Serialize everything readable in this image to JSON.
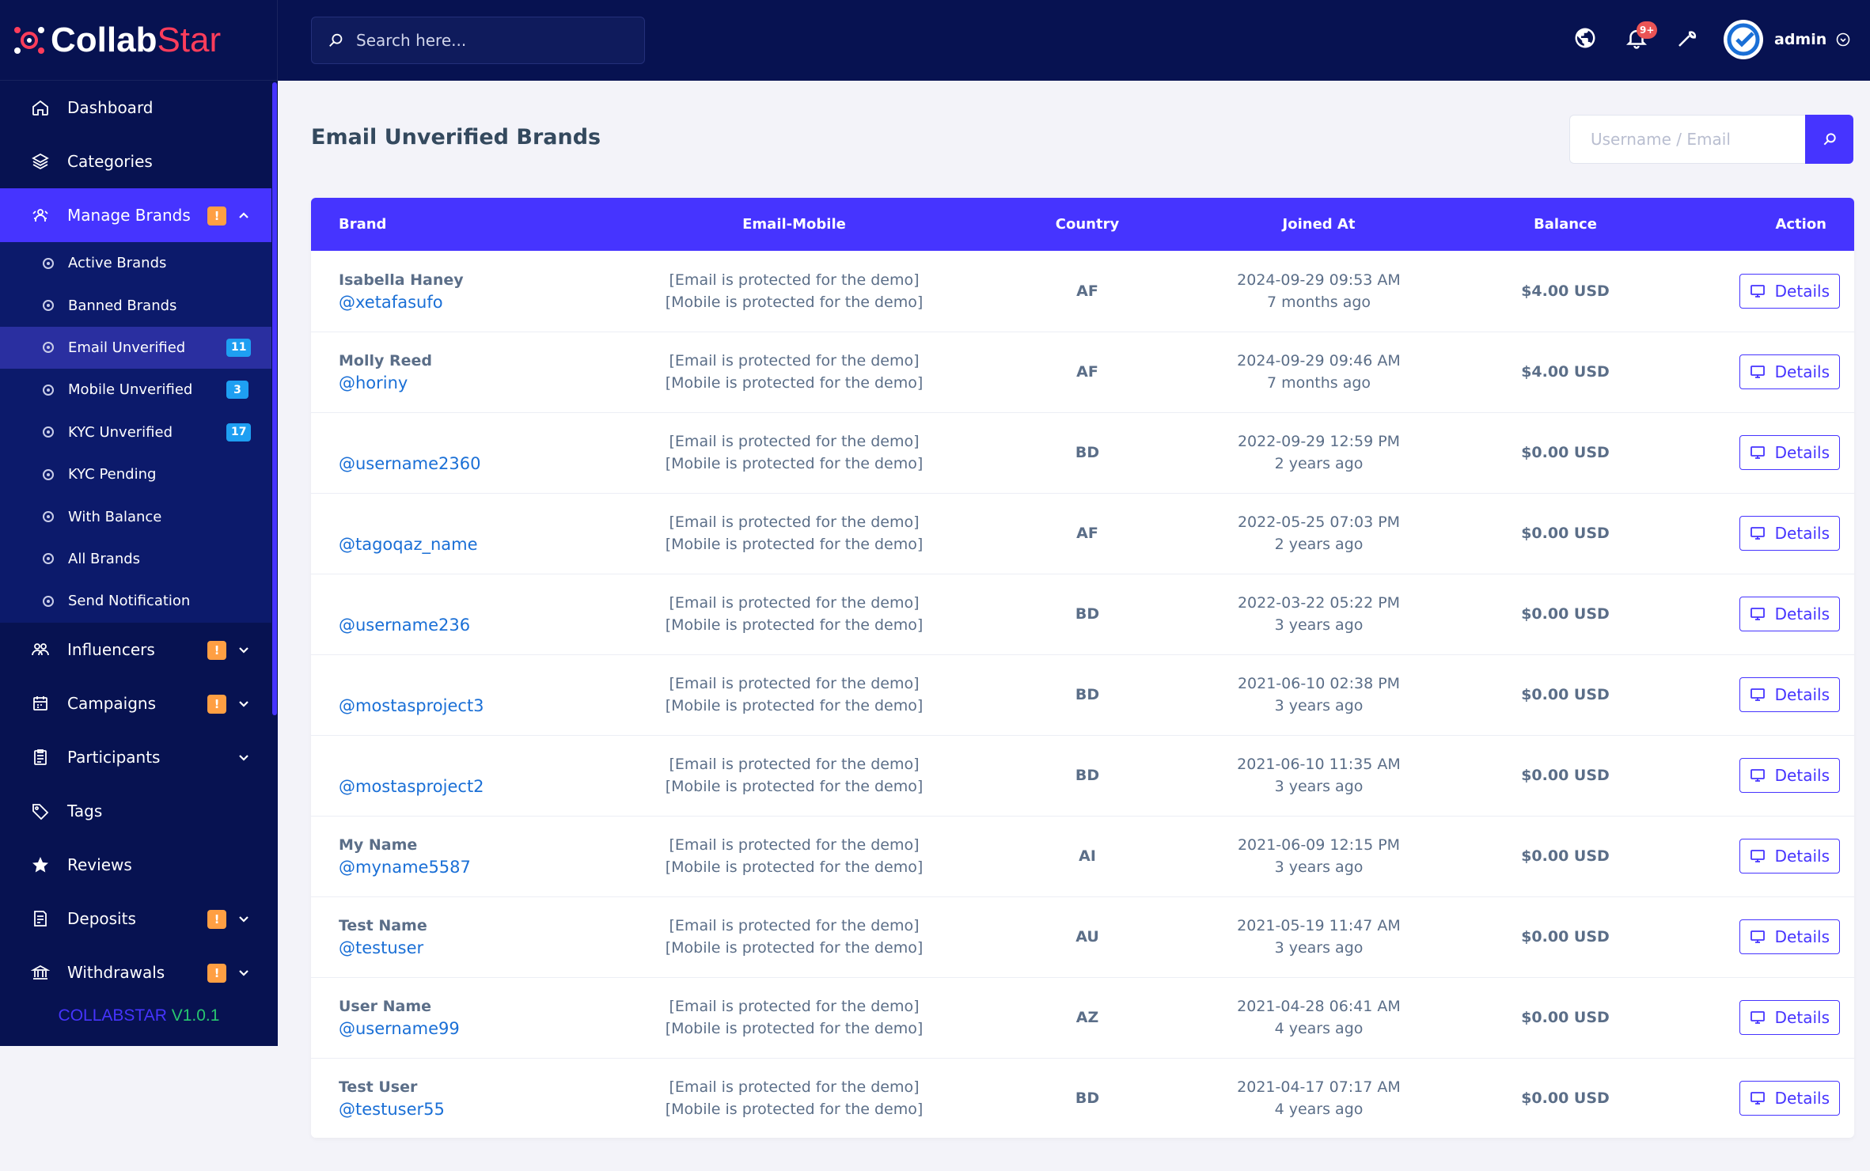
{
  "app": {
    "brand_main": "Collab",
    "brand_accent": "Star",
    "version_name": "COLLABSTAR",
    "version_number": "V1.0.1"
  },
  "sidebar": {
    "items": [
      {
        "label": "Dashboard",
        "icon": "home-icon"
      },
      {
        "label": "Categories",
        "icon": "layers-icon"
      },
      {
        "label": "Manage Brands",
        "icon": "brands-icon",
        "warn": "!",
        "expanded": true
      },
      {
        "label": "Influencers",
        "icon": "users-icon",
        "warn": "!"
      },
      {
        "label": "Campaigns",
        "icon": "calendar-icon",
        "warn": "!"
      },
      {
        "label": "Participants",
        "icon": "clipboard-icon"
      },
      {
        "label": "Tags",
        "icon": "tag-icon"
      },
      {
        "label": "Reviews",
        "icon": "star-icon"
      },
      {
        "label": "Deposits",
        "icon": "receipt-icon",
        "warn": "!"
      },
      {
        "label": "Withdrawals",
        "icon": "bank-icon",
        "warn": "!"
      }
    ],
    "submenu": [
      {
        "label": "Active Brands"
      },
      {
        "label": "Banned Brands"
      },
      {
        "label": "Email Unverified",
        "badge": "11"
      },
      {
        "label": "Mobile Unverified",
        "badge": "3"
      },
      {
        "label": "KYC Unverified",
        "badge": "17"
      },
      {
        "label": "KYC Pending"
      },
      {
        "label": "With Balance"
      },
      {
        "label": "All Brands"
      },
      {
        "label": "Send Notification"
      }
    ]
  },
  "topbar": {
    "search_placeholder": "Search here...",
    "notification_count": "9+",
    "user_name": "admin"
  },
  "main": {
    "title": "Email Unverified Brands",
    "filter_placeholder": "Username / Email",
    "columns": [
      "Brand",
      "Email-Mobile",
      "Country",
      "Joined At",
      "Balance",
      "Action"
    ],
    "rows": [
      {
        "name": "Isabella Haney",
        "username": "@xetafasufo",
        "email": "[Email is protected for the demo]",
        "mobile": "[Mobile is protected for the demo]",
        "country": "AF",
        "joined": "2024-09-29 09:53 AM",
        "ago": "7 months ago",
        "balance": "$4.00 USD",
        "action": "Details"
      },
      {
        "name": "Molly Reed",
        "username": "@horiny",
        "email": "[Email is protected for the demo]",
        "mobile": "[Mobile is protected for the demo]",
        "country": "AF",
        "joined": "2024-09-29 09:46 AM",
        "ago": "7 months ago",
        "balance": "$4.00 USD",
        "action": "Details"
      },
      {
        "name": "",
        "username": "@username2360",
        "email": "[Email is protected for the demo]",
        "mobile": "[Mobile is protected for the demo]",
        "country": "BD",
        "joined": "2022-09-29 12:59 PM",
        "ago": "2 years ago",
        "balance": "$0.00 USD",
        "action": "Details"
      },
      {
        "name": "",
        "username": "@tagoqaz_name",
        "email": "[Email is protected for the demo]",
        "mobile": "[Mobile is protected for the demo]",
        "country": "AF",
        "joined": "2022-05-25 07:03 PM",
        "ago": "2 years ago",
        "balance": "$0.00 USD",
        "action": "Details"
      },
      {
        "name": "",
        "username": "@username236",
        "email": "[Email is protected for the demo]",
        "mobile": "[Mobile is protected for the demo]",
        "country": "BD",
        "joined": "2022-03-22 05:22 PM",
        "ago": "3 years ago",
        "balance": "$0.00 USD",
        "action": "Details"
      },
      {
        "name": "",
        "username": "@mostasproject3",
        "email": "[Email is protected for the demo]",
        "mobile": "[Mobile is protected for the demo]",
        "country": "BD",
        "joined": "2021-06-10 02:38 PM",
        "ago": "3 years ago",
        "balance": "$0.00 USD",
        "action": "Details"
      },
      {
        "name": "",
        "username": "@mostasproject2",
        "email": "[Email is protected for the demo]",
        "mobile": "[Mobile is protected for the demo]",
        "country": "BD",
        "joined": "2021-06-10 11:35 AM",
        "ago": "3 years ago",
        "balance": "$0.00 USD",
        "action": "Details"
      },
      {
        "name": "My Name",
        "username": "@myname5587",
        "email": "[Email is protected for the demo]",
        "mobile": "[Mobile is protected for the demo]",
        "country": "AI",
        "joined": "2021-06-09 12:15 PM",
        "ago": "3 years ago",
        "balance": "$0.00 USD",
        "action": "Details"
      },
      {
        "name": "Test Name",
        "username": "@testuser",
        "email": "[Email is protected for the demo]",
        "mobile": "[Mobile is protected for the demo]",
        "country": "AU",
        "joined": "2021-05-19 11:47 AM",
        "ago": "3 years ago",
        "balance": "$0.00 USD",
        "action": "Details"
      },
      {
        "name": "User Name",
        "username": "@username99",
        "email": "[Email is protected for the demo]",
        "mobile": "[Mobile is protected for the demo]",
        "country": "AZ",
        "joined": "2021-04-28 06:41 AM",
        "ago": "4 years ago",
        "balance": "$0.00 USD",
        "action": "Details"
      },
      {
        "name": "Test User",
        "username": "@testuser55",
        "email": "[Email is protected for the demo]",
        "mobile": "[Mobile is protected for the demo]",
        "country": "BD",
        "joined": "2021-04-17 07:17 AM",
        "ago": "4 years ago",
        "balance": "$0.00 USD",
        "action": "Details"
      }
    ]
  },
  "colors": {
    "sidebar_bg": "#071251",
    "accent": "#4634ff",
    "warning": "#ff9f43",
    "info_badge": "#1e9ff2",
    "link": "#1a6fd6"
  }
}
